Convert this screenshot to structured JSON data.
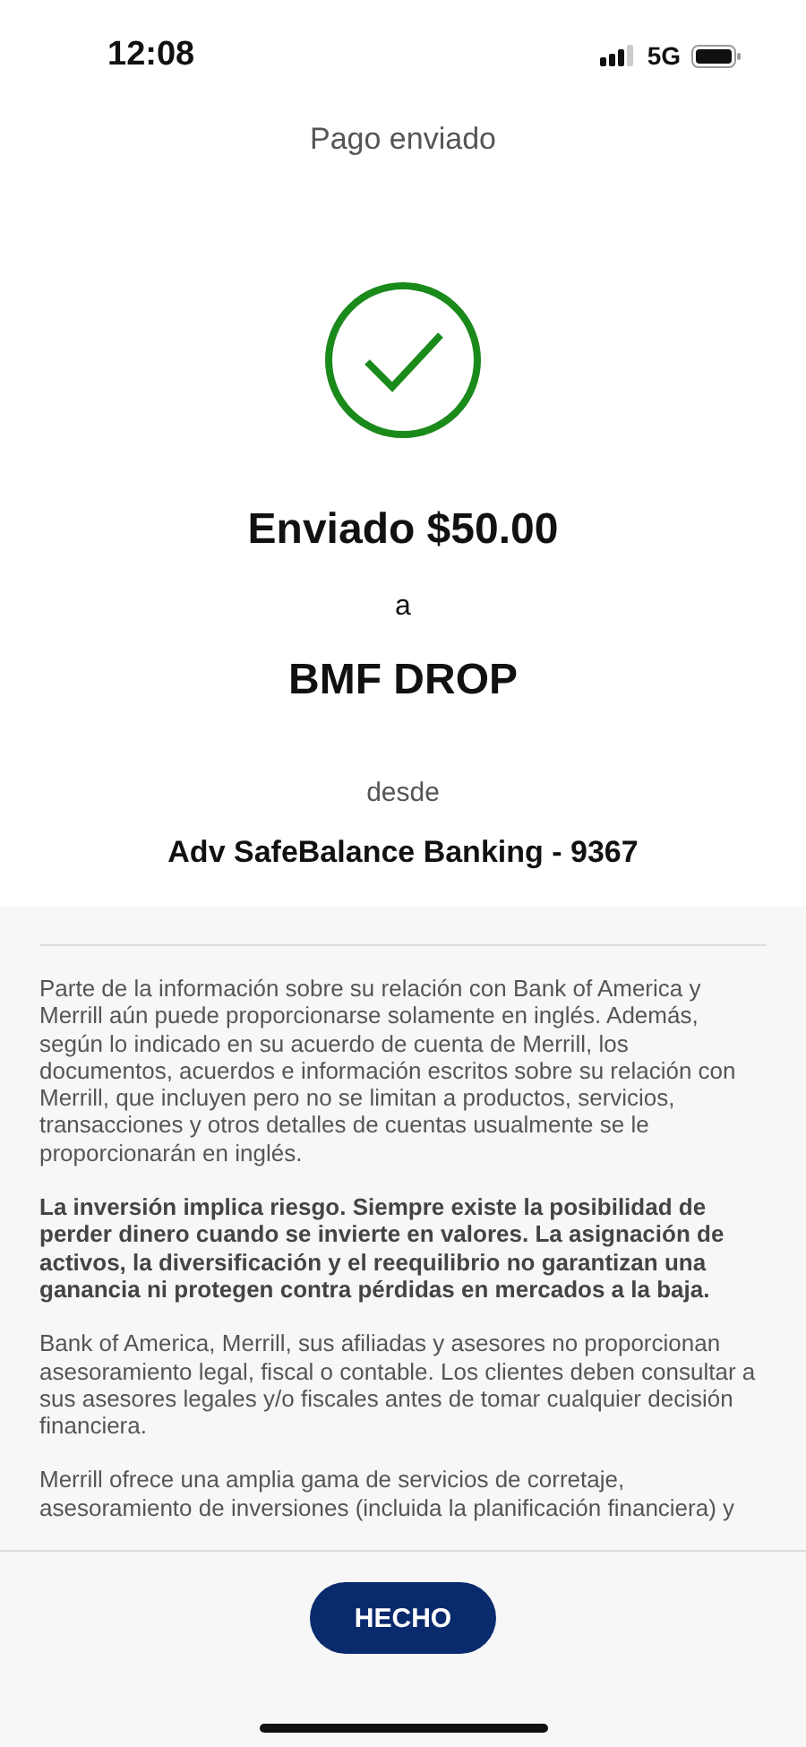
{
  "status_bar": {
    "time": "12:08",
    "network": "5G"
  },
  "header": {
    "title": "Pago enviado"
  },
  "confirmation": {
    "kind": "success",
    "amount_line": "Enviado $50.00",
    "to_word": "a",
    "recipient": "BMF DROP",
    "from_word": "desde",
    "account": "Adv SafeBalance Banking - 9367"
  },
  "disclosures": [
    {
      "kind": "normal",
      "text": "Parte de la información sobre su relación con Bank of America y Merrill aún puede proporcionarse solamente en inglés. Además, según lo indicado en su acuerdo de cuenta de Merrill, los documentos, acuerdos e información escritos sobre su relación con Merrill, que incluyen pero no se limitan a productos, servicios, transacciones y otros detalles de cuentas usualmente se le proporcionarán en inglés."
    },
    {
      "kind": "bold",
      "text": "La inversión implica riesgo. Siempre existe la posibilidad de perder dinero cuando se invierte en valores. La asignación de activos, la diversificación y el reequilibrio no garantizan una ganancia ni protegen contra pérdidas en mercados a la baja."
    },
    {
      "kind": "normal",
      "text": "Bank of America, Merrill, sus afiliadas y asesores no proporcionan asesoramiento legal, fiscal o contable. Los clientes deben consultar a sus asesores legales y/o fiscales antes de tomar cualquier decisión financiera."
    },
    {
      "kind": "normal",
      "text": "Merrill ofrece una amplia gama de servicios de corretaje, asesoramiento de inversiones (incluida la planificación financiera) y"
    }
  ],
  "footer": {
    "button": "HECHO"
  }
}
